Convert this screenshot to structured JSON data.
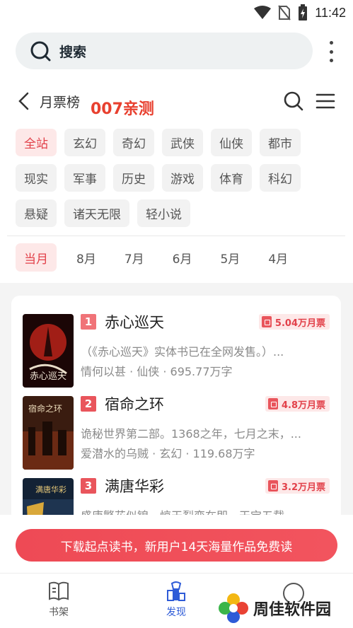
{
  "status_bar": {
    "time": "11:42"
  },
  "search": {
    "label": "搜索"
  },
  "header": {
    "title": "月票榜",
    "watermark": "007亲测"
  },
  "categories": [
    "全站",
    "玄幻",
    "奇幻",
    "武侠",
    "仙侠",
    "都市",
    "现实",
    "军事",
    "历史",
    "游戏",
    "体育",
    "科幻",
    "悬疑",
    "诸天无限",
    "轻小说"
  ],
  "months": [
    "当月",
    "8月",
    "7月",
    "6月",
    "5月",
    "4月"
  ],
  "books": [
    {
      "rank": "1",
      "title": "赤心巡天",
      "tickets": "5.04万月票",
      "desc": "（《赤心巡天》实体书已在全网发售。）...",
      "meta": "情何以甚 · 仙侠 · 695.77万字",
      "cover_text": "赤心巡天"
    },
    {
      "rank": "2",
      "title": "宿命之环",
      "tickets": "4.8万月票",
      "desc": "诡秘世界第二部。1368之年，七月之末，...",
      "meta": "爱潜水的乌贼 · 玄幻 · 119.68万字",
      "cover_text": "宿命之环"
    },
    {
      "rank": "3",
      "title": "满唐华彩",
      "tickets": "3.2万月票",
      "desc": "盛唐繁花似锦，惊天裂变在即。天宝五载...",
      "meta": "",
      "cover_text": "满唐华彩"
    }
  ],
  "banner": {
    "text": "下载起点读书，新用户14天海量作品免费读"
  },
  "bottom_nav": [
    {
      "label": "书架",
      "icon": "book-icon"
    },
    {
      "label": "发现",
      "icon": "discover-icon"
    },
    {
      "label": "",
      "icon": "circle-icon"
    }
  ],
  "site_logo": {
    "name": "周佳软件园"
  },
  "colors": {
    "accent": "#e2414a",
    "nav_active": "#2e5bd7"
  }
}
